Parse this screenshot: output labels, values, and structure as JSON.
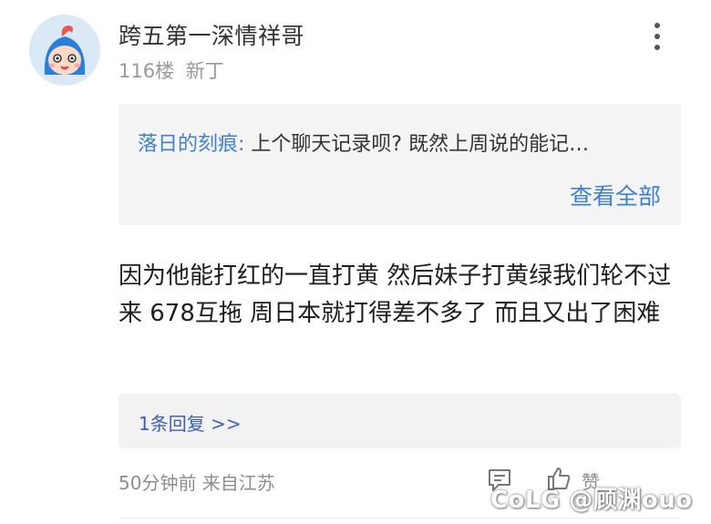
{
  "post": {
    "username": "跨五第一深情祥哥",
    "floor": "116楼",
    "badge": "新丁",
    "quote": {
      "author": "落日的刻痕:",
      "text": " 上个聊天记录呗?   既然上周说的能记…",
      "view_all": "查看全部"
    },
    "content": "因为他能打红的一直打黄 然后妹子打黄绿我们轮不过来 678互拖 周日本就打得差不多了 而且又出了困难",
    "reply_link": "1条回复 >>",
    "time_location": "50分钟前 来自江苏",
    "like_label": "赞",
    "watermark": "CoLG @顾渊ouo"
  },
  "icons": {
    "more": "more-vertical-icon",
    "comment": "comment-icon",
    "like": "thumbs-up-icon"
  },
  "colors": {
    "link_blue": "#3f7fd0",
    "reply_blue": "#3f5fb5",
    "quote_bg": "#f4f4f4",
    "muted_text": "#9a9a9a"
  }
}
